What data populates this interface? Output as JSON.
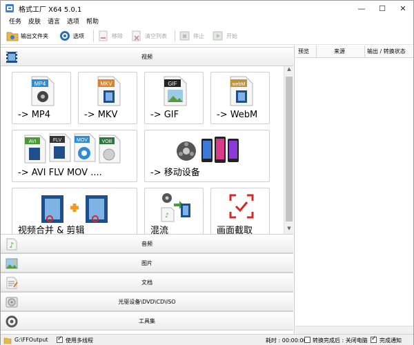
{
  "window": {
    "title": "格式工厂 X64 5.0.1"
  },
  "menu": {
    "items": [
      "任务",
      "皮肤",
      "语言",
      "选项",
      "帮助"
    ]
  },
  "toolbar": {
    "output_folder": "输出文件夹",
    "options": "选项",
    "remove": "移除",
    "clear_list": "清空列表",
    "stop": "停止",
    "start": "开始"
  },
  "categories": {
    "video": "视频",
    "audio": "音频",
    "image": "图片",
    "document": "文档",
    "disc": "光驱设备\\DVD\\CD\\ISO",
    "tools": "工具集"
  },
  "tiles": {
    "mp4": {
      "label": "-> MP4",
      "badge": "MP4",
      "badge_color": "#2e8bd6"
    },
    "mkv": {
      "label": "-> MKV",
      "badge": "MKV",
      "badge_color": "#d9822b"
    },
    "gif": {
      "label": "-> GIF",
      "badge": "GIF",
      "badge_color": "#222222"
    },
    "webm": {
      "label": "-> WebM",
      "badge": "webM",
      "badge_color": "#c0923a"
    },
    "avi": {
      "label": "-> AVI FLV MOV ....",
      "badges": [
        "AVI",
        "FLV",
        "MOV",
        "VOB"
      ]
    },
    "mobile": {
      "label": "-> 移动设备"
    },
    "merge": {
      "label": "视频合并 & 剪辑"
    },
    "mix": {
      "label": "混流"
    },
    "record": {
      "label": "画面截取"
    }
  },
  "task_list": {
    "columns": [
      "预览",
      "来源",
      "输出 / 转换状态"
    ]
  },
  "status_bar": {
    "output_path": "G:\\FFOutput",
    "multithread_label": "使用多线程",
    "multithread_checked": true,
    "elapsed": "耗时 : 00:00:00",
    "after_done_label": "转换完成后 : 关闭电脑",
    "after_done_checked": false,
    "notify_label": "完成通知",
    "notify_checked": true
  },
  "colors": {
    "accent": "#2e8bd6",
    "disabled": "#a8a8a8",
    "record_red": "#d62828"
  }
}
